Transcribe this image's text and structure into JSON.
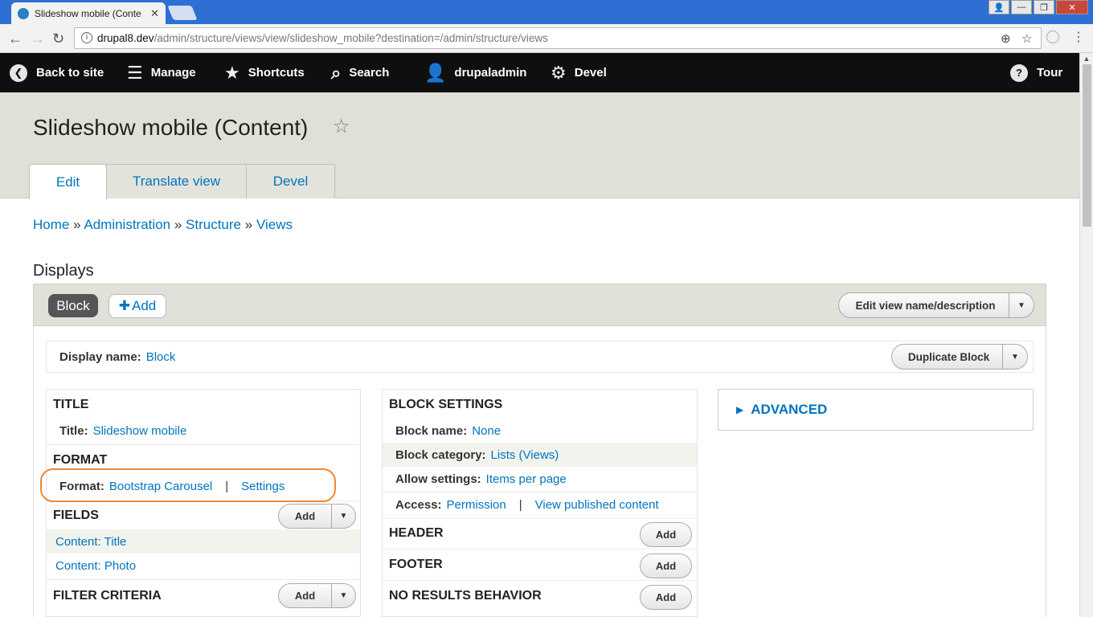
{
  "browser": {
    "tab_title": "Slideshow mobile (Conte",
    "tab_close": "✕",
    "url_host": "drupal8.dev",
    "url_path": "/admin/structure/views/view/slideshow_mobile?destination=/admin/structure/views",
    "window_buttons": [
      "👤",
      "—",
      "❐",
      "✕"
    ]
  },
  "toolbar": {
    "back": "Back to site",
    "manage": "Manage",
    "shortcuts": "Shortcuts",
    "search": "Search",
    "user": "drupaladmin",
    "devel": "Devel",
    "tour": "Tour"
  },
  "page": {
    "title": "Slideshow mobile (Content)",
    "tabs": [
      "Edit",
      "Translate view",
      "Devel"
    ],
    "breadcrumb": [
      "Home",
      "Administration",
      "Structure",
      "Views"
    ],
    "breadcrumb_sep": "»",
    "displays_heading": "Displays"
  },
  "displays": {
    "active": "Block",
    "add": "Add",
    "edit_name": "Edit view name/description",
    "display_name_label": "Display name:",
    "display_name_value": "Block",
    "duplicate": "Duplicate Block"
  },
  "left_column": {
    "title_heading": "TITLE",
    "title_label": "Title:",
    "title_value": "Slideshow mobile",
    "format_heading": "FORMAT",
    "format_label": "Format:",
    "format_value": "Bootstrap Carousel",
    "format_settings": "Settings",
    "separator": "|",
    "fields_heading": "FIELDS",
    "fields": [
      "Content: Title",
      "Content: Photo"
    ],
    "filter_heading": "FILTER CRITERIA",
    "add_label": "Add"
  },
  "middle_column": {
    "block_settings_heading": "BLOCK SETTINGS",
    "block_name_label": "Block name:",
    "block_name_value": "None",
    "block_category_label": "Block category:",
    "block_category_value": "Lists (Views)",
    "allow_settings_label": "Allow settings:",
    "allow_settings_value": "Items per page",
    "access_label": "Access:",
    "access_value": "Permission",
    "access_extra": "View published content",
    "separator": "|",
    "header_heading": "HEADER",
    "footer_heading": "FOOTER",
    "no_results_heading": "NO RESULTS BEHAVIOR",
    "add_label": "Add"
  },
  "right_column": {
    "advanced": "ADVANCED"
  }
}
